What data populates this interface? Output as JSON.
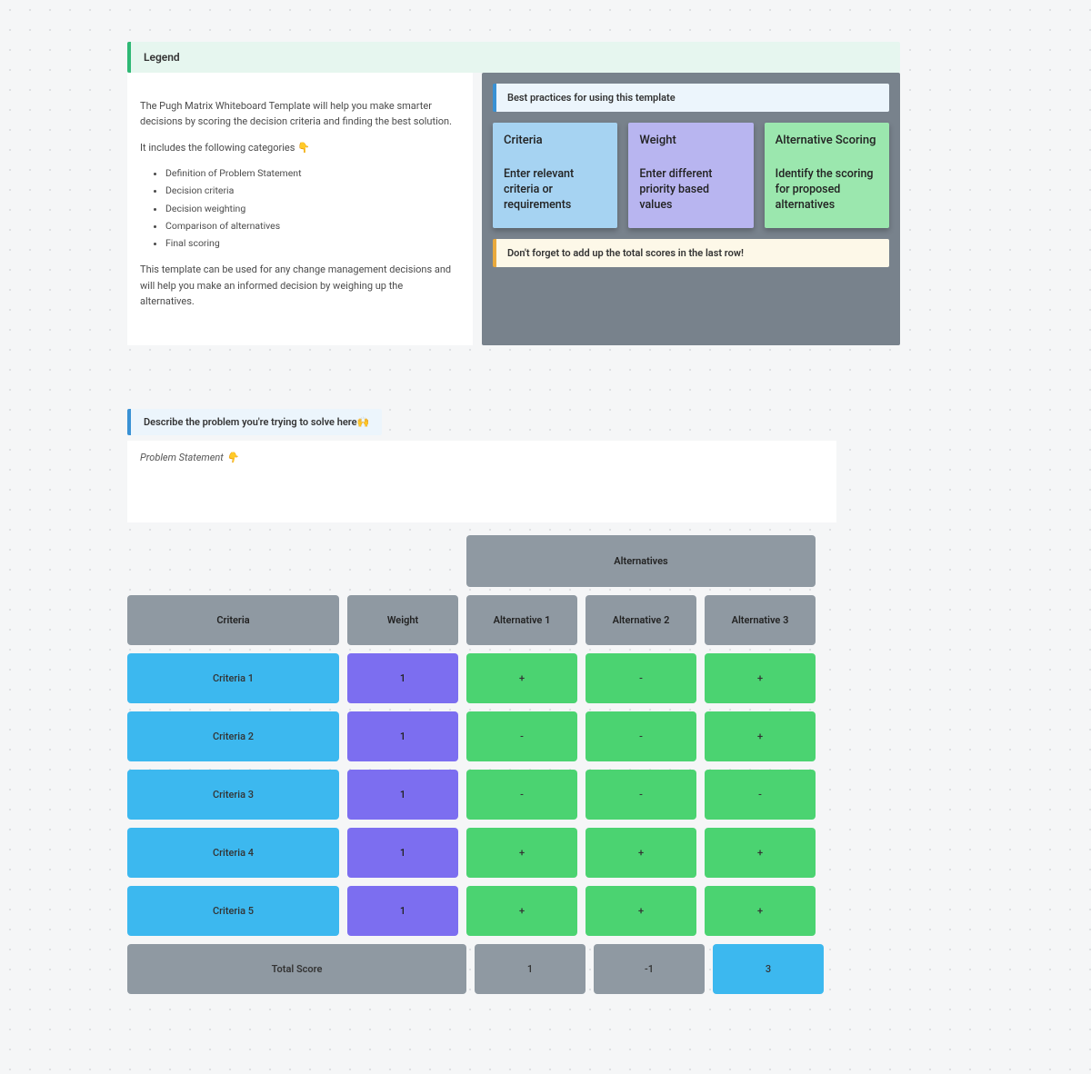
{
  "legend": {
    "title": "Legend"
  },
  "description": {
    "intro": "The Pugh Matrix Whiteboard Template will help you make smarter decisions by scoring the decision criteria and finding the best solution.",
    "includes_label": "It includes the following categories 👇",
    "categories": [
      "Definition of Problem Statement",
      "Decision criteria",
      "Decision weighting",
      "Comparison of alternatives",
      "Final scoring"
    ],
    "outro": "This template can be used for any change management decisions and will help you make an informed decision by weighing up the alternatives."
  },
  "practices": {
    "header": "Best practices for using this template",
    "cards": [
      {
        "title": "Criteria",
        "body": "Enter relevant criteria or requirements"
      },
      {
        "title": "Weight",
        "body": "Enter different priority based values"
      },
      {
        "title": "Alternative Scoring",
        "body": "Identify the scoring for proposed alternatives"
      }
    ],
    "footer": "Don't forget to add up the total scores in the last row!"
  },
  "problem": {
    "label": "Describe the problem you're trying to solve here🙌",
    "placeholder": "Problem Statement  👇"
  },
  "matrix": {
    "alternatives_header": "Alternatives",
    "headers": {
      "criteria": "Criteria",
      "weight": "Weight",
      "alt1": "Alternative 1",
      "alt2": "Alternative 2",
      "alt3": "Alternative 3"
    },
    "rows": [
      {
        "criteria": "Criteria 1",
        "weight": "1",
        "alt1": "+",
        "alt2": "-",
        "alt3": "+"
      },
      {
        "criteria": "Criteria 2",
        "weight": "1",
        "alt1": "-",
        "alt2": "-",
        "alt3": "+"
      },
      {
        "criteria": "Criteria 3",
        "weight": "1",
        "alt1": "-",
        "alt2": "-",
        "alt3": "-"
      },
      {
        "criteria": "Criteria 4",
        "weight": "1",
        "alt1": "+",
        "alt2": "+",
        "alt3": "+"
      },
      {
        "criteria": "Criteria 5",
        "weight": "1",
        "alt1": "+",
        "alt2": "+",
        "alt3": "+"
      }
    ],
    "total": {
      "label": "Total Score",
      "alt1": "1",
      "alt2": "-1",
      "alt3": "3"
    }
  }
}
